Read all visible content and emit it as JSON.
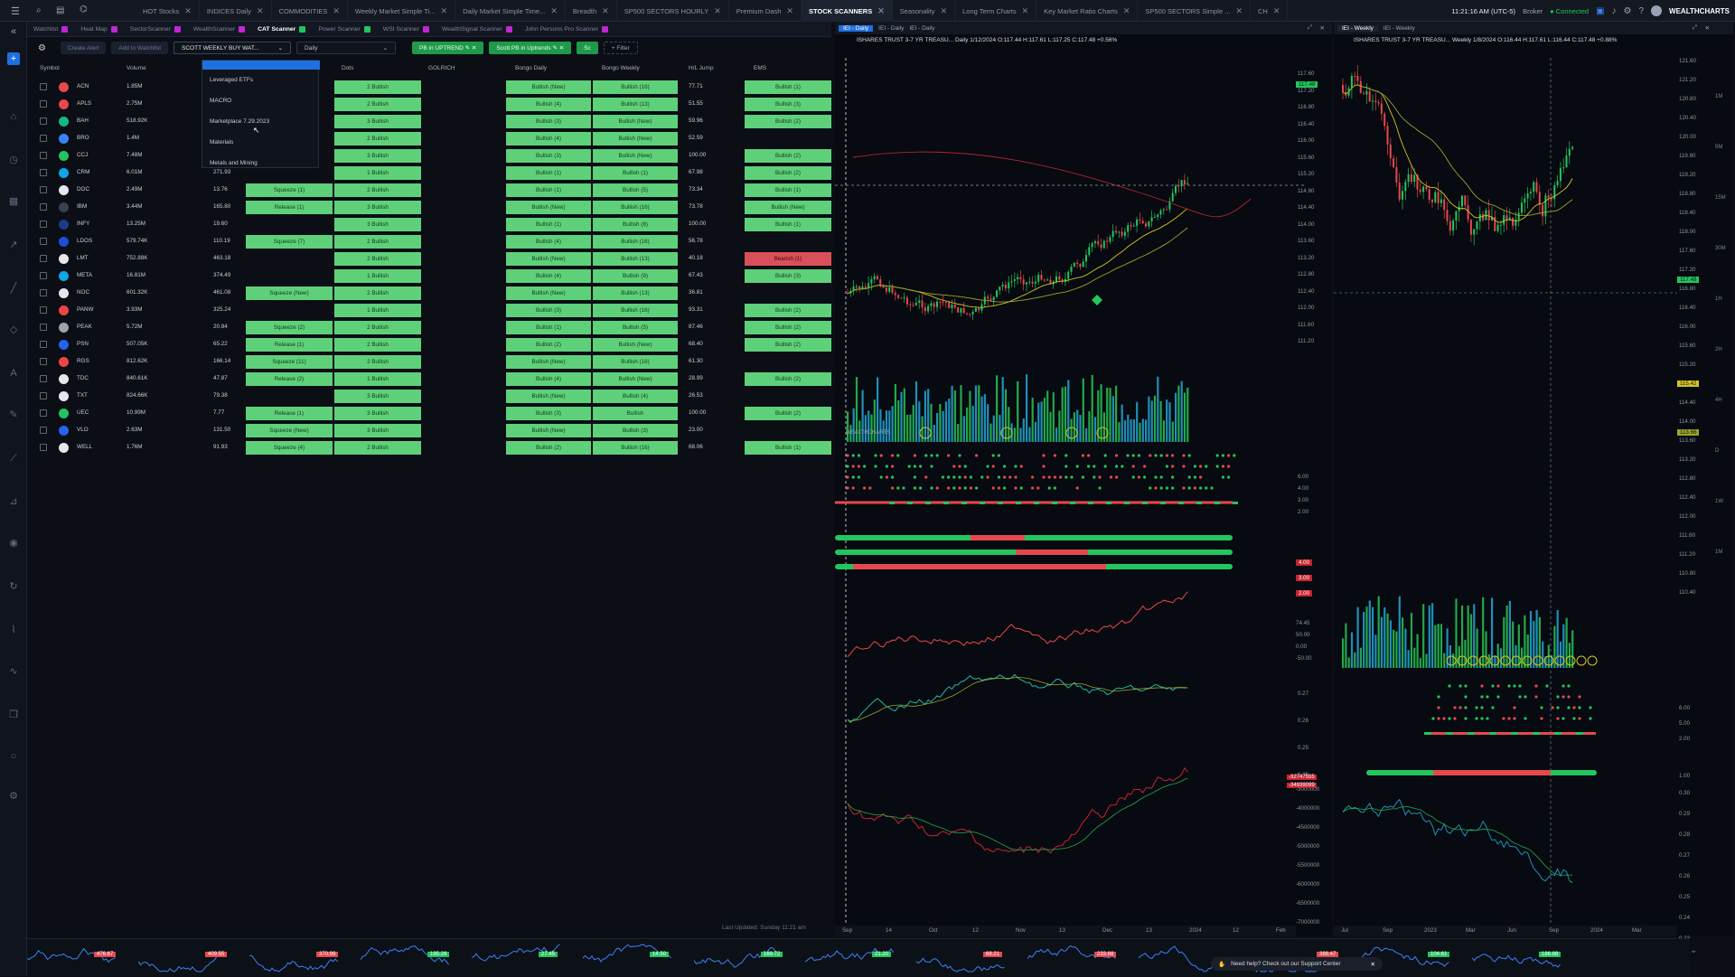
{
  "topbar": {
    "tabs": [
      "HOT Stocks",
      "INDICES Daily",
      "COMMODITIES",
      "Weekly Market Simple Ti...",
      "Daily Market Simple Time...",
      "Breadth",
      "SP500 SECTORS HOURLY",
      "Premium Dash",
      "STOCK SCANNERS",
      "Seasonality",
      "Long Term Charts",
      "Key Market Ratio Charts",
      "SP500 SECTORS Simple ...",
      "CH"
    ],
    "active_tab": "STOCK SCANNERS",
    "clock": "11:21:16 AM (UTC-5)",
    "broker": "Broker",
    "connected": "Connected",
    "brand": "WEALTHCHARTS"
  },
  "subtabs": [
    {
      "label": "Watchlist",
      "color": "#c026d3"
    },
    {
      "label": "Heat Map",
      "color": "#c026d3"
    },
    {
      "label": "SectorScanner",
      "color": "#c026d3"
    },
    {
      "label": "WealthScanner",
      "color": "#c026d3"
    },
    {
      "label": "CAT Scanner",
      "color": "#22c55e"
    },
    {
      "label": "Power Scanner",
      "color": "#22c55e"
    },
    {
      "label": "WSI Scanner",
      "color": "#c026d3"
    },
    {
      "label": "WealthSignal Scanner",
      "color": "#c026d3"
    },
    {
      "label": "John Persons Pro Scanner",
      "color": "#c026d3"
    }
  ],
  "toolbar": {
    "create_alert": "Create Alert",
    "add_watchlist": "Add to Watchlist",
    "scanner_select": "SCOTT WEEKLY BUY WAT...",
    "timeframe": "Daily",
    "filter1": "PB in UPTREND",
    "filter2": "Scott PB in Uptrends",
    "filter3": "Sc",
    "add_filter": "+ Filter"
  },
  "dropdown_menu": [
    "Leveraged ETFs",
    "MACRO",
    "Marketplace 7.29.2023",
    "Materials",
    "Metals and Mining"
  ],
  "table": {
    "headers": [
      "Symbol",
      "Volume",
      "Dots",
      "GOLRICH",
      "Bongo Daily",
      "Bongo Weekly",
      "H/L Jump",
      "EMS"
    ],
    "rows": [
      {
        "sym": "ACN",
        "vol": "1.85M",
        "price": "",
        "sq": "",
        "dots": "2 Bullish",
        "bd": "Bullish (New)",
        "bw": "Bullish (16)",
        "hl": "77.71",
        "ems": "Bullish (1)",
        "logo": "#e5484d"
      },
      {
        "sym": "APLS",
        "vol": "2.75M",
        "price": "",
        "sq": "",
        "dots": "2 Bullish",
        "bd": "Bullish (4)",
        "bw": "Bullish (13)",
        "hl": "51.55",
        "ems": "Bullish (3)",
        "logo": "#e5484d"
      },
      {
        "sym": "BAH",
        "vol": "518.92K",
        "price": "",
        "sq": "",
        "dots": "3 Bullish",
        "bd": "Bullish (3)",
        "bw": "Bullish (New)",
        "hl": "59.96",
        "ems": "Bullish (2)",
        "logo": "#10b981"
      },
      {
        "sym": "BRO",
        "vol": "1.4M",
        "price": "",
        "sq": "",
        "dots": "2 Bullish",
        "bd": "Bullish (4)",
        "bw": "Bullish (New)",
        "hl": "52.59",
        "ems": "",
        "logo": "#3b82f6"
      },
      {
        "sym": "CCJ",
        "vol": "7.48M",
        "price": "",
        "sq": "",
        "dots": "3 Bullish",
        "bd": "Bullish (3)",
        "bw": "Bullish (New)",
        "hl": "100.00",
        "ems": "Bullish (2)",
        "logo": "#22c55e"
      },
      {
        "sym": "CRM",
        "vol": "6.01M",
        "price": "271.93",
        "sq": "",
        "dots": "1 Bullish",
        "bd": "Bullish (1)",
        "bw": "Bullish (1)",
        "hl": "67.98",
        "ems": "Bullish (2)",
        "logo": "#0ea5e9"
      },
      {
        "sym": "DOC",
        "vol": "2.49M",
        "price": "13.76",
        "sq": "Squeeze (1)",
        "dots": "2 Bullish",
        "bd": "Bullish (1)",
        "bw": "Bullish (5)",
        "hl": "73.34",
        "ems": "Bullish (1)",
        "logo": "#e5e7eb"
      },
      {
        "sym": "IBM",
        "vol": "3.44M",
        "price": "165.80",
        "sq": "Release (1)",
        "dots": "3 Bullish",
        "bd": "Bullish (New)",
        "bw": "Bullish (16)",
        "hl": "73.78",
        "ems": "Bullish (New)",
        "logo": "#374151"
      },
      {
        "sym": "INFY",
        "vol": "13.25M",
        "price": "19.60",
        "sq": "",
        "dots": "3 Bullish",
        "bd": "Bullish (1)",
        "bw": "Bullish (8)",
        "hl": "100.00",
        "ems": "Bullish (1)",
        "logo": "#1e3a8a"
      },
      {
        "sym": "LDOS",
        "vol": "579.74K",
        "price": "110.19",
        "sq": "Squeeze (7)",
        "dots": "2 Bullish",
        "bd": "Bullish (4)",
        "bw": "Bullish (16)",
        "hl": "56.78",
        "ems": "",
        "logo": "#1d4ed8"
      },
      {
        "sym": "LMT",
        "vol": "752.88K",
        "price": "463.18",
        "sq": "",
        "dots": "2 Bullish",
        "bd": "Bullish (New)",
        "bw": "Bullish (13)",
        "hl": "40.18",
        "ems": "Bearish (1)",
        "logo": "#e5e7eb"
      },
      {
        "sym": "META",
        "vol": "16.81M",
        "price": "374.49",
        "sq": "",
        "dots": "1 Bullish",
        "bd": "Bullish (4)",
        "bw": "Bullish (9)",
        "hl": "67.43",
        "ems": "Bullish (3)",
        "logo": "#0ea5e9"
      },
      {
        "sym": "NOC",
        "vol": "601.32K",
        "price": "461.08",
        "sq": "Squeeze (New)",
        "dots": "2 Bullish",
        "bd": "Bullish (New)",
        "bw": "Bullish (13)",
        "hl": "36.81",
        "ems": "",
        "logo": "#e5e7eb"
      },
      {
        "sym": "PANW",
        "vol": "3.93M",
        "price": "325.24",
        "sq": "",
        "dots": "1 Bullish",
        "bd": "Bullish (3)",
        "bw": "Bullish (16)",
        "hl": "93.31",
        "ems": "Bullish (2)",
        "logo": "#ef4444"
      },
      {
        "sym": "PEAK",
        "vol": "5.72M",
        "price": "20.84",
        "sq": "Squeeze (2)",
        "dots": "2 Bullish",
        "bd": "Bullish (1)",
        "bw": "Bullish (5)",
        "hl": "87.46",
        "ems": "Bullish (2)",
        "logo": "#9ca3af"
      },
      {
        "sym": "PSN",
        "vol": "507.05K",
        "price": "65.22",
        "sq": "Release (1)",
        "dots": "2 Bullish",
        "bd": "Bullish (2)",
        "bw": "Bullish (New)",
        "hl": "68.40",
        "ems": "Bullish (2)",
        "logo": "#2563eb"
      },
      {
        "sym": "RGS",
        "vol": "812.62K",
        "price": "166.14",
        "sq": "Squeeze (11)",
        "dots": "2 Bullish",
        "bd": "Bullish (New)",
        "bw": "Bullish (16)",
        "hl": "61.30",
        "ems": "",
        "logo": "#ef4444"
      },
      {
        "sym": "TDC",
        "vol": "840.61K",
        "price": "47.87",
        "sq": "Release (2)",
        "dots": "1 Bullish",
        "bd": "Bullish (4)",
        "bw": "Bullish (New)",
        "hl": "28.99",
        "ems": "Bullish (2)",
        "logo": "#e5e7eb"
      },
      {
        "sym": "TXT",
        "vol": "824.66K",
        "price": "79.38",
        "sq": "",
        "dots": "3 Bullish",
        "bd": "Bullish (New)",
        "bw": "Bullish (4)",
        "hl": "26.53",
        "ems": "",
        "logo": "#e5e7eb"
      },
      {
        "sym": "UEC",
        "vol": "10.99M",
        "price": "7.77",
        "sq": "Release (1)",
        "dots": "3 Bullish",
        "bd": "Bullish (3)",
        "bw": "Bullish",
        "hl": "100.00",
        "ems": "Bullish (2)",
        "logo": "#22c55e"
      },
      {
        "sym": "VLO",
        "vol": "2.63M",
        "price": "131.50",
        "sq": "Squeeze (New)",
        "dots": "3 Bullish",
        "bd": "Bullish (New)",
        "bw": "Bullish (3)",
        "hl": "23.00",
        "ems": "",
        "logo": "#2563eb"
      },
      {
        "sym": "WELL",
        "vol": "1.76M",
        "price": "91.93",
        "sq": "Squeeze (4)",
        "dots": "2 Bullish",
        "bd": "Bullish (2)",
        "bw": "Bullish (16)",
        "hl": "68.06",
        "ems": "Bullish (1)",
        "logo": "#e5e7eb"
      }
    ]
  },
  "last_updated": "Last Updated: Sunday 11:21 am",
  "chart_left": {
    "tab": "IEI - Daily",
    "tab2": "IEI - Daily",
    "tab3": "IEI - Daily",
    "title": "ISHARES TRUST 3-7 YR TREASU... Daily 1/12/2024 O:117.44 H:117.61 L:117.25 C:117.48 +0.56%",
    "price_tag": "117.48",
    "price_levels": [
      "117.60",
      "117.20",
      "116.80",
      "116.40",
      "116.00",
      "115.60",
      "115.20",
      "114.80",
      "114.40",
      "114.00",
      "113.60",
      "113.20",
      "112.80",
      "112.40",
      "112.00",
      "111.60",
      "111.20"
    ],
    "osc_labels": [
      "6.00",
      "4.00",
      "3.00",
      "2.00"
    ],
    "bar_labels": [
      "4.00",
      "3.00",
      "2.00"
    ],
    "rsi_labels": [
      "74.45",
      "50.00",
      "0.00",
      "-50.00"
    ],
    "ratio_labels": [
      "0.27",
      "0.26",
      "0.25",
      "3.25"
    ],
    "cum_labels": [
      "-3000000",
      "-4000000",
      "-4500000",
      "-5000000",
      "-5500000",
      "-6000000",
      "-6500000",
      "-7000000"
    ],
    "x_labels": [
      "Sep",
      "14",
      "Oct",
      "12",
      "Nov",
      "13",
      "Dec",
      "13",
      "2024",
      "12",
      "Feb"
    ],
    "watermark": "WEALTHCHARTS"
  },
  "chart_right": {
    "tab": "IEI - Weekly",
    "tab2": "IEI - Weekly",
    "title": "ISHARES TRUST 3-7 YR TREASU... Weekly 1/8/2024 O:116.44 H:117.61 L:116.44 C:117.48 +0.88%",
    "price_tag": "117.48",
    "price_tag2": "115.42",
    "price_tag3": "113.66",
    "price_levels": [
      "121.60",
      "121.20",
      "120.80",
      "120.40",
      "120.00",
      "119.60",
      "119.20",
      "118.80",
      "118.40",
      "118.00",
      "117.60",
      "117.20",
      "116.80",
      "116.40",
      "116.00",
      "115.60",
      "115.20",
      "114.80",
      "114.40",
      "114.00",
      "113.60",
      "113.20",
      "112.80",
      "112.40",
      "112.00",
      "111.60",
      "111.20",
      "110.80",
      "110.40"
    ],
    "osc_labels": [
      "6.00",
      "5.00",
      "2.00"
    ],
    "bar_label": "1.00",
    "cum_labels": [
      "-32747555",
      "-34939099"
    ],
    "low_labels": [
      "0.30",
      "0.29",
      "0.28",
      "0.27",
      "0.26",
      "0.25",
      "0.24",
      "0.23"
    ],
    "x_labels": [
      "Jul",
      "Sep",
      "2023",
      "Mar",
      "Jun",
      "Sep",
      "2024",
      "Mar"
    ],
    "timeframes": [
      "1M",
      "5M",
      "15M",
      "30M",
      "1H",
      "2H",
      "4H",
      "D",
      "1W",
      "1M"
    ]
  },
  "mini_tickers": [
    {
      "val": "476.67",
      "color": "#e5484d"
    },
    {
      "val": "409.55",
      "color": "#e5484d"
    },
    {
      "val": "370.99",
      "color": "#e5484d"
    },
    {
      "val": "195.26",
      "color": "#22c55e"
    },
    {
      "val": "27.45",
      "color": "#22c55e"
    },
    {
      "val": "14.50",
      "color": "#22c55e"
    },
    {
      "val": "169.72",
      "color": "#22c55e"
    },
    {
      "val": "21.20",
      "color": "#22c55e"
    },
    {
      "val": "68.21",
      "color": "#e5484d"
    },
    {
      "val": "233.68",
      "color": "#e5484d"
    },
    {
      "val": "",
      "color": "#e5484d"
    },
    {
      "val": "388.47",
      "color": "#e5484d"
    },
    {
      "val": "104.61",
      "color": "#22c55e"
    },
    {
      "val": "186.88",
      "color": "#22c55e"
    }
  ],
  "help": {
    "text": "Need help? Check out our Support Center"
  }
}
